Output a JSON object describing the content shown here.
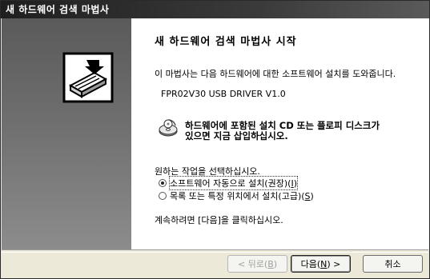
{
  "window": {
    "title": "새 하드웨어 검색 마법사"
  },
  "main": {
    "heading": "새 하드웨어 검색 마법사 시작",
    "intro": "이 마법사는 다음 하드웨어에 대한 소프트웨어 설치를 도와줍니다.",
    "device": "FPR02V30 USB DRIVER V1.0",
    "cd_message_line1": "하드웨어에 포함된 설치 CD 또는 플로피 디스크가",
    "cd_message_line2": "있으면 지금 삽입하십시오.",
    "prompt": "원하는 작업을 선택하십시오.",
    "options": [
      {
        "label": "소프트웨어 자동으로 설치(권장)",
        "hotkey": "I",
        "selected": true
      },
      {
        "label": "목록 또는 특정 위치에서 설치(고급)",
        "hotkey": "S",
        "selected": false
      }
    ],
    "continue_msg": "계속하려면 [다음]을 클릭하십시오."
  },
  "buttons": {
    "back_pre": "< 뒤로(",
    "back_key": "B",
    "back_post": ")",
    "next_pre": "다음(",
    "next_key": "N",
    "next_post": ") >",
    "cancel": "취소"
  },
  "icons": {
    "wizard": "hardware-wizard-icon",
    "cd": "cd-icon"
  }
}
